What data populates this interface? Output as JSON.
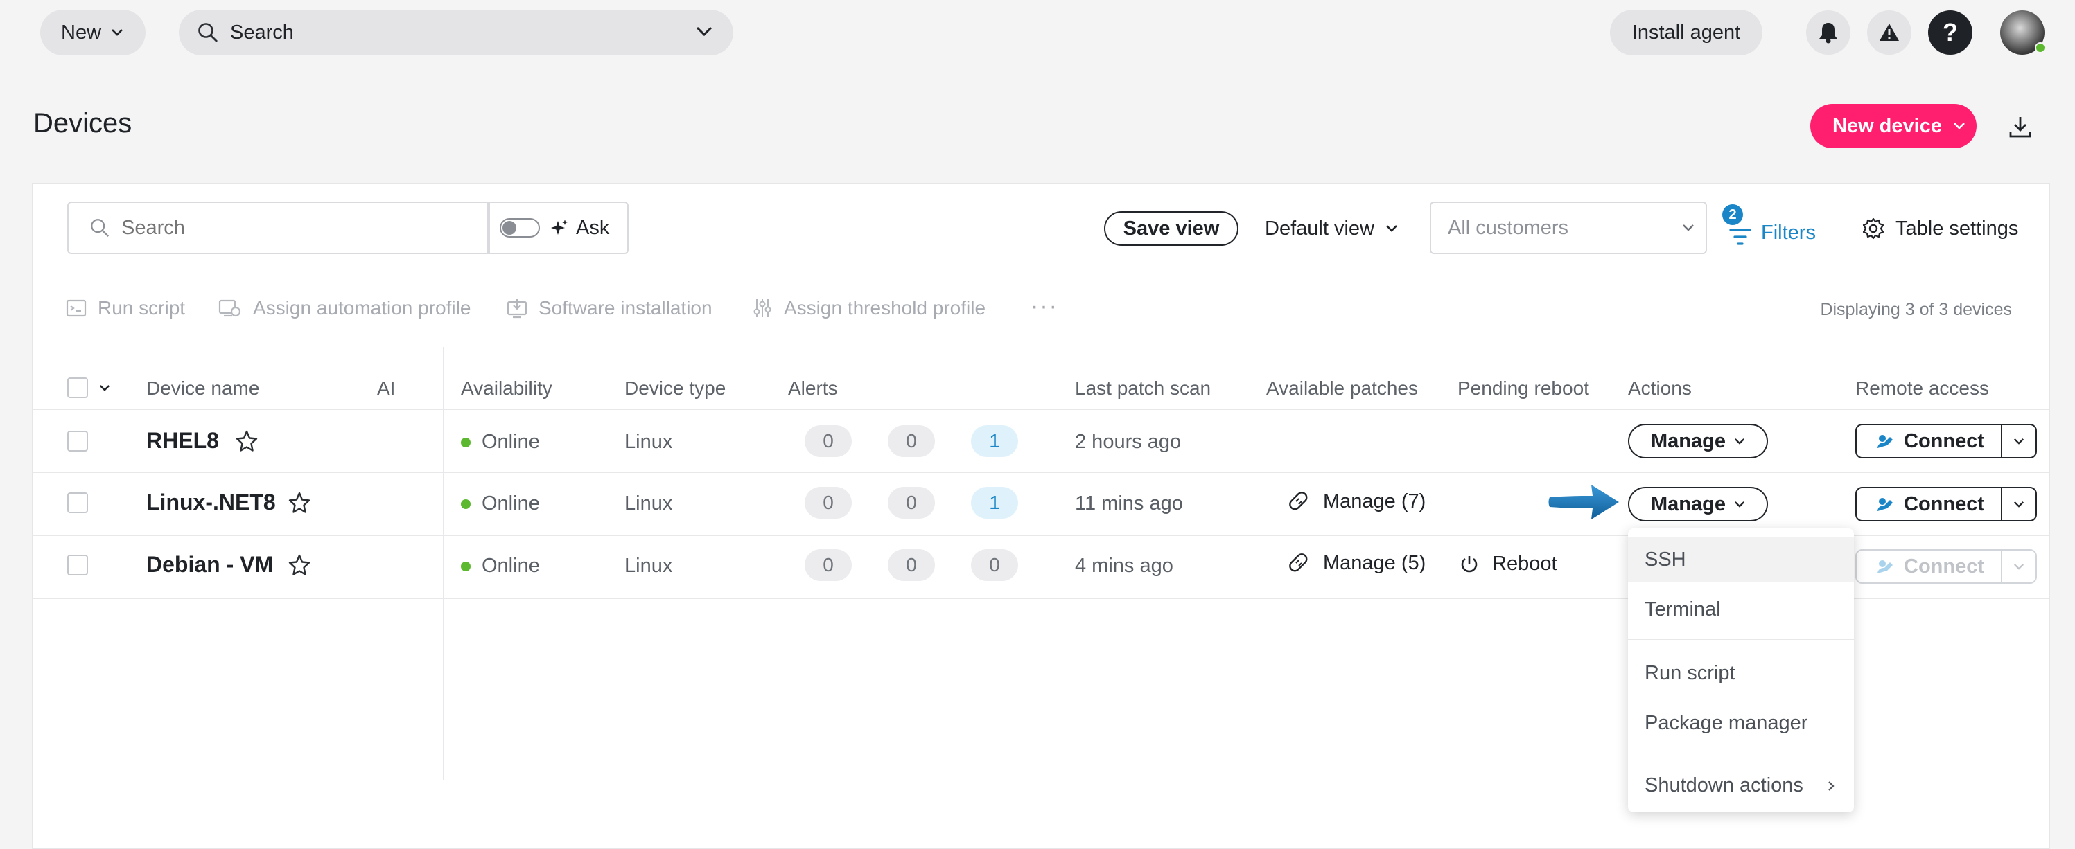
{
  "topbar": {
    "new_label": "New",
    "search_label": "Search",
    "install_agent_label": "Install agent"
  },
  "header": {
    "title": "Devices",
    "new_device_label": "New device"
  },
  "toolbar": {
    "search_placeholder": "Search",
    "ask_label": "Ask",
    "save_view_label": "Save view",
    "default_view_label": "Default view",
    "customers_placeholder": "All customers",
    "filters_count": "2",
    "filters_label": "Filters",
    "table_settings_label": "Table settings"
  },
  "bulk_actions": {
    "run_script": "Run script",
    "assign_automation_profile": "Assign automation profile",
    "software_installation": "Software installation",
    "assign_threshold_profile": "Assign threshold profile",
    "more": "···",
    "display_count": "Displaying 3 of 3 devices"
  },
  "table": {
    "columns": {
      "device_name": "Device name",
      "ai": "AI",
      "availability": "Availability",
      "device_type": "Device type",
      "alerts": "Alerts",
      "last_patch_scan": "Last patch scan",
      "available_patches": "Available patches",
      "pending_reboot": "Pending reboot",
      "actions": "Actions",
      "remote_access": "Remote access"
    },
    "rows": [
      {
        "name": "RHEL8",
        "availability": "Online",
        "type": "Linux",
        "alert1": "0",
        "alert2": "0",
        "alert3": "1",
        "last_scan": "2 hours ago",
        "patches": "",
        "reboot": "",
        "manage": "Manage",
        "connect": "Connect"
      },
      {
        "name": "Linux-.NET8",
        "availability": "Online",
        "type": "Linux",
        "alert1": "0",
        "alert2": "0",
        "alert3": "1",
        "last_scan": "11 mins ago",
        "patches": "Manage (7)",
        "reboot": "",
        "manage": "Manage",
        "connect": "Connect"
      },
      {
        "name": "Debian - VM",
        "availability": "Online",
        "type": "Linux",
        "alert1": "0",
        "alert2": "0",
        "alert3": "0",
        "last_scan": "4 mins ago",
        "patches": "Manage (5)",
        "reboot": "Reboot",
        "manage": "Manage",
        "connect": "Connect"
      }
    ]
  },
  "manage_menu": {
    "items": [
      "SSH",
      "Terminal",
      "Run script",
      "Package manager",
      "Shutdown actions"
    ]
  },
  "colors": {
    "accent_pink": "#ff1f6e",
    "online_green": "#5cb82e",
    "link_blue": "#1b86c7",
    "arrow_blue": "#1e7fc4"
  },
  "icons": [
    "chevron-down-icon",
    "search-icon",
    "bell-icon",
    "warning-icon",
    "help-icon",
    "avatar",
    "download-icon",
    "sparkle-icon",
    "filter-icon",
    "gear-icon",
    "star-icon",
    "bandage-icon",
    "power-icon",
    "connect-icon",
    "chevron-right-icon",
    "arrow-pointer"
  ]
}
